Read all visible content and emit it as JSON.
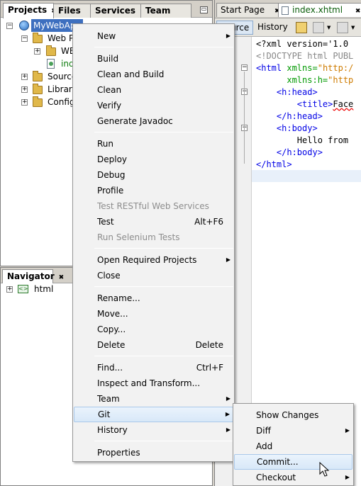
{
  "projects_panel": {
    "tabs": [
      {
        "label": "Projects",
        "close": "✖"
      },
      {
        "label": "Files"
      },
      {
        "label": "Services"
      },
      {
        "label": "Team"
      }
    ],
    "minimize": "▭",
    "tree": [
      {
        "label": "MyWebApp"
      },
      {
        "label": "Web Pa"
      },
      {
        "label": "WEB"
      },
      {
        "label": "inde"
      },
      {
        "label": "Source"
      },
      {
        "label": "Librarie"
      },
      {
        "label": "Configu"
      }
    ]
  },
  "navigator_panel": {
    "tab": {
      "label": "Navigator",
      "close": "✖"
    },
    "tree": [
      {
        "label": "html"
      }
    ]
  },
  "editor": {
    "tabs": [
      {
        "label": "Start Page",
        "close": "✖"
      },
      {
        "label": "index.xhtml",
        "close": "✖"
      }
    ],
    "toolbar": {
      "source": "Source",
      "history": "History"
    },
    "code": [
      {
        "text": "<?xml version='1.0"
      },
      {
        "text": "<!DOCTYPE html PUBL"
      },
      {
        "tag": "<html ",
        "attr": "xmlns=",
        "str": "\"http:/"
      },
      {
        "attr": "      xmlns:h=",
        "str": "\"http"
      },
      {
        "tag": "    <h:head>"
      },
      {
        "tag": "        <title>",
        "text": "Face"
      },
      {
        "tag": "    </h:head>"
      },
      {
        "tag": "    <h:body>"
      },
      {
        "text": "        Hello from"
      },
      {
        "tag": "    </h:body>"
      },
      {
        "tag": "</html>"
      }
    ]
  },
  "context_menu": {
    "items": [
      {
        "label": "New",
        "submenu": true
      },
      {
        "sep": true
      },
      {
        "label": "Build"
      },
      {
        "label": "Clean and Build"
      },
      {
        "label": "Clean"
      },
      {
        "label": "Verify"
      },
      {
        "label": "Generate Javadoc"
      },
      {
        "sep": true
      },
      {
        "label": "Run"
      },
      {
        "label": "Deploy"
      },
      {
        "label": "Debug"
      },
      {
        "label": "Profile"
      },
      {
        "label": "Test RESTful Web Services",
        "disabled": true
      },
      {
        "label": "Test",
        "shortcut": "Alt+F6"
      },
      {
        "label": "Run Selenium Tests",
        "disabled": true
      },
      {
        "sep": true
      },
      {
        "label": "Open Required Projects",
        "submenu": true
      },
      {
        "label": "Close"
      },
      {
        "sep": true
      },
      {
        "label": "Rename..."
      },
      {
        "label": "Move..."
      },
      {
        "label": "Copy..."
      },
      {
        "label": "Delete",
        "shortcut": "Delete"
      },
      {
        "sep": true
      },
      {
        "label": "Find...",
        "shortcut": "Ctrl+F"
      },
      {
        "label": "Inspect and Transform..."
      },
      {
        "label": "Team",
        "submenu": true
      },
      {
        "label": "Git",
        "submenu": true,
        "highlighted": true
      },
      {
        "label": "History",
        "submenu": true
      },
      {
        "sep": true
      },
      {
        "label": "Properties"
      }
    ]
  },
  "git_submenu": {
    "items": [
      {
        "label": "Show Changes"
      },
      {
        "label": "Diff",
        "submenu": true
      },
      {
        "label": "Add"
      },
      {
        "label": "Commit...",
        "highlighted": true
      },
      {
        "label": "Checkout",
        "submenu": true
      }
    ]
  },
  "icons": {
    "submenu_arrow": "▶",
    "expand": "+",
    "collapse": "−"
  }
}
